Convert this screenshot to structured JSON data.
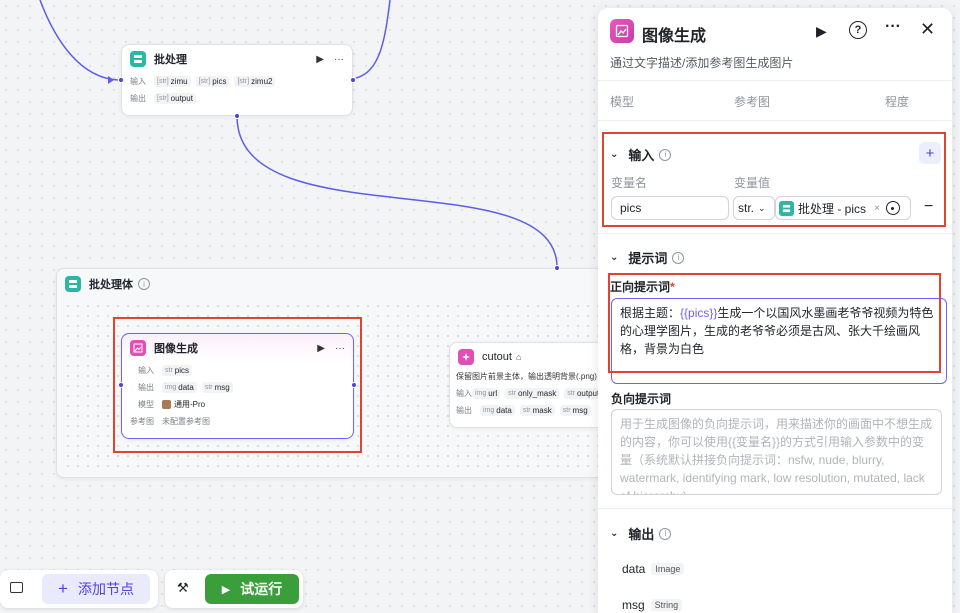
{
  "colors": {
    "accent": "#4e40e5",
    "run_green": "#3a9e3a",
    "highlight_red": "#e0432f",
    "node_teal": "#2eb6a4",
    "node_pink": "#e04fb5"
  },
  "batch_node": {
    "title": "批处理",
    "input_label": "输入",
    "output_label": "输出",
    "inputs": [
      {
        "type": "[str]",
        "name": "zimu"
      },
      {
        "type": "[str]",
        "name": "pics"
      },
      {
        "type": "[str]",
        "name": "zimu2"
      }
    ],
    "outputs": [
      {
        "type": "[str]",
        "name": "output"
      }
    ]
  },
  "batch_body": {
    "title": "批处理体"
  },
  "image_node": {
    "title": "图像生成",
    "input_label": "输入",
    "output_label": "输出",
    "model_label": "模型",
    "ref_label": "参考图",
    "input_chip": {
      "type": "str",
      "name": "pics"
    },
    "output_chips": [
      {
        "type": "img",
        "name": "data"
      },
      {
        "type": "str",
        "name": "msg"
      }
    ],
    "model_value": "通用-Pro",
    "ref_value": "未配置参考图"
  },
  "cutout_node": {
    "title": "cutout",
    "desc": "保留图片前景主体，输出透明背景(.png)",
    "input_label": "输入",
    "output_label": "输出",
    "inputs": [
      {
        "type": "img",
        "name": "url"
      },
      {
        "type": "str",
        "name": "only_mask"
      },
      {
        "type": "str",
        "name": "output"
      }
    ],
    "outputs": [
      {
        "type": "img",
        "name": "data"
      },
      {
        "type": "str",
        "name": "mask"
      },
      {
        "type": "str",
        "name": "msg"
      }
    ]
  },
  "panel": {
    "title": "图像生成",
    "subtitle": "通过文字描述/添加参考图生成图片",
    "tabs": [
      "模型",
      "参考图",
      "程度"
    ],
    "input_section": {
      "title": "输入",
      "col_name": "变量名",
      "col_value": "变量值",
      "var_name": "pics",
      "type_select": "str.",
      "ref_source": "批处理 - pics"
    },
    "prompt_section": {
      "title": "提示词",
      "positive_label": "正向提示词",
      "required_mark": "*",
      "positive_prefix": "根据主题：",
      "positive_var": "{{pics}}",
      "positive_rest": "生成一个以国风水墨画老爷爷视频为特色的心理学图片，生成的老爷爷必须是古风、张大千绘画风格，背景为白色",
      "negative_label": "负向提示词",
      "negative_placeholder": "用于生成图像的负向提示词，用来描述你的画面中不想生成的内容，你可以使用{{变量名}}的方式引用输入参数中的变量（系统默认拼接负向提示词：nsfw, nude, blurry, watermark, identifying mark, low resolution, mutated, lack of hierarchy)"
    },
    "output_section": {
      "title": "输出",
      "items": [
        {
          "name": "data",
          "type": "Image"
        },
        {
          "name": "msg",
          "type": "String"
        }
      ]
    }
  },
  "toolbar": {
    "add_node": "添加节点",
    "test_run": "试运行"
  }
}
